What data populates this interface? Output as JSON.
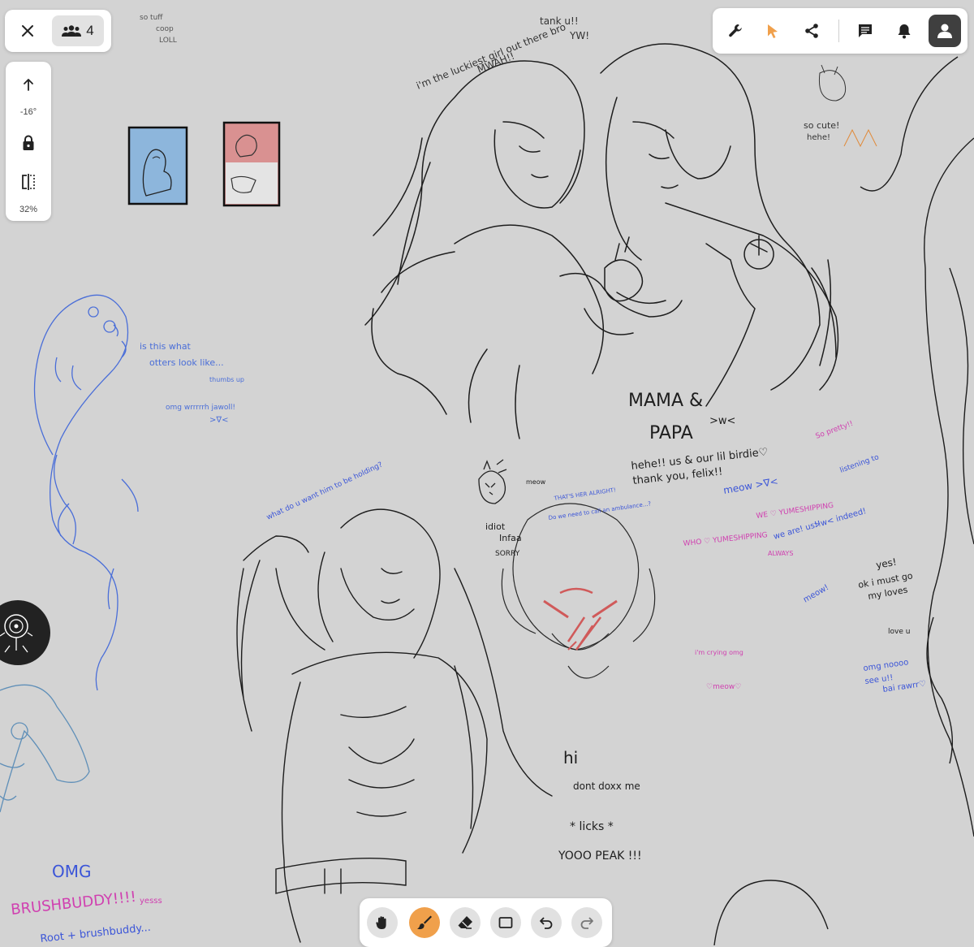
{
  "app": {
    "users_count": "4",
    "rotation_label": "-16°",
    "zoom_label": "32%"
  },
  "theme": {
    "canvas_bg": "#d3d3d3",
    "active_tool": "#f0a04b",
    "cursor_accent": "#f0a04b",
    "avatar_bg": "#3f3f3f"
  },
  "toolbar_top_right": {
    "items": [
      "settings-wrench-icon",
      "select-pointer-icon",
      "share-icon",
      "chat-icon",
      "notification-bell-icon",
      "account-avatar-icon"
    ]
  },
  "toolbar_bottom": {
    "tools": [
      {
        "name": "hand-pan",
        "active": false
      },
      {
        "name": "brush",
        "active": true
      },
      {
        "name": "eraser",
        "active": false
      },
      {
        "name": "rectangle",
        "active": false
      },
      {
        "name": "undo",
        "active": false
      },
      {
        "name": "redo",
        "active": false
      }
    ]
  },
  "scribbles": {
    "luckiest": "i'm the luckiest girl out there bro",
    "mwah": "MWAH!!",
    "tank": "tank u!!",
    "yw": "YW!",
    "so_cute": "so cute!",
    "hehe_small": "hehe!",
    "otter1": "is this what",
    "otter2": "otters look like...",
    "otter3": "thumbs up",
    "otter4": "omg wrrrrrh jawoll!",
    "otter5": ">∇<",
    "mama": "MAMA &",
    "papa": "PAPA",
    "wc": ">w<",
    "hehe_birdie": "hehe!! us & our lil birdie♡",
    "thank_felix": "thank you, felix!!",
    "meow1": "meow >∇<",
    "we_yume": "WE ♡ YUMESHIPPING",
    "we_are": "we are! us!!",
    "indeed": ">w< indeed!",
    "always": "ALWAYS",
    "who_yume": "WHO ♡ YUMESHIPPING",
    "so_pretty": "So pretty!!",
    "listening": "listening to",
    "delicious": "ok i must go",
    "my_loves": "my loves",
    "yes": "yes!",
    "love_u": "love u",
    "omg_nooo": "omg noooo",
    "see_u": "see u!!",
    "bai": "bai rawrr♡",
    "meow2": "meow!",
    "idiot": "idiot",
    "infaa": "Infaa",
    "sorry": "SORRY",
    "meow_small": "meow",
    "thats_her": "THAT'S HER ALRIGHT!",
    "ambulance": "Do we need to call an ambulance...?",
    "what_do_u": "what do u want him to be holding?",
    "im_crying": "i'm crying omg",
    "meow_heart": "♡meow♡",
    "hi": "hi",
    "dont_doxx": "dont doxx me",
    "licks": "* licks *",
    "yooo": "YOOO PEAK !!!",
    "omg": "OMG",
    "brushbuddy": "BRUSHBUDDY!!!!",
    "yessss": "yesss",
    "root": "Root + brushbuddy...",
    "so_tuff": "so tuff",
    "coop": "coop",
    "loll": "LOLL",
    "yes_pink": "yesss",
    "hehe_pink": "hehe"
  }
}
